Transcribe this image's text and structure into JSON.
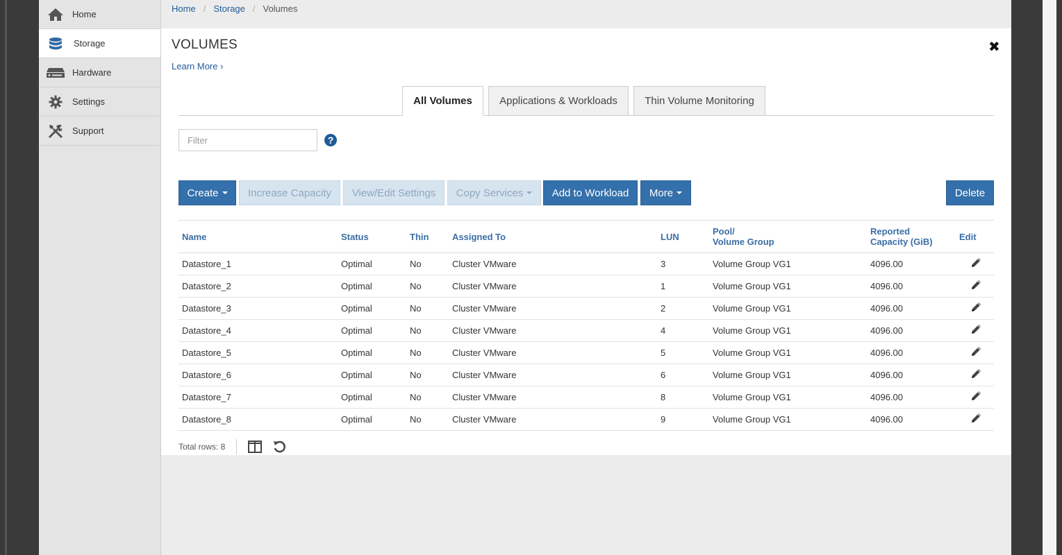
{
  "sidebar": {
    "items": [
      {
        "label": "Home",
        "icon": "home-icon"
      },
      {
        "label": "Storage",
        "icon": "database-icon"
      },
      {
        "label": "Hardware",
        "icon": "hardware-icon"
      },
      {
        "label": "Settings",
        "icon": "gear-icon"
      },
      {
        "label": "Support",
        "icon": "tools-icon"
      }
    ],
    "active": "Storage"
  },
  "breadcrumb": [
    "Home",
    "Storage",
    "Volumes"
  ],
  "page": {
    "title": "VOLUMES",
    "learn_more": "Learn More ›"
  },
  "tabs": [
    {
      "label": "All Volumes",
      "active": true
    },
    {
      "label": "Applications & Workloads",
      "active": false
    },
    {
      "label": "Thin Volume Monitoring",
      "active": false
    }
  ],
  "filter": {
    "placeholder": "Filter",
    "value": ""
  },
  "toolbar": {
    "create": "Create",
    "increase_capacity": "Increase Capacity",
    "view_edit": "View/Edit Settings",
    "copy_services": "Copy Services",
    "add_to_workload": "Add to Workload",
    "more": "More",
    "delete": "Delete"
  },
  "table": {
    "headers": {
      "name": "Name",
      "status": "Status",
      "thin": "Thin",
      "assigned": "Assigned To",
      "lun": "LUN",
      "pool_1": "Pool/",
      "pool_2": "Volume Group",
      "cap_1": "Reported",
      "cap_2": "Capacity (GiB)",
      "edit": "Edit"
    },
    "rows": [
      {
        "name": "Datastore_1",
        "status": "Optimal",
        "thin": "No",
        "assigned": "Cluster VMware",
        "lun": "3",
        "pool": "Volume Group VG1",
        "capacity": "4096.00"
      },
      {
        "name": "Datastore_2",
        "status": "Optimal",
        "thin": "No",
        "assigned": "Cluster VMware",
        "lun": "1",
        "pool": "Volume Group VG1",
        "capacity": "4096.00"
      },
      {
        "name": "Datastore_3",
        "status": "Optimal",
        "thin": "No",
        "assigned": "Cluster VMware",
        "lun": "2",
        "pool": "Volume Group VG1",
        "capacity": "4096.00"
      },
      {
        "name": "Datastore_4",
        "status": "Optimal",
        "thin": "No",
        "assigned": "Cluster VMware",
        "lun": "4",
        "pool": "Volume Group VG1",
        "capacity": "4096.00"
      },
      {
        "name": "Datastore_5",
        "status": "Optimal",
        "thin": "No",
        "assigned": "Cluster VMware",
        "lun": "5",
        "pool": "Volume Group VG1",
        "capacity": "4096.00"
      },
      {
        "name": "Datastore_6",
        "status": "Optimal",
        "thin": "No",
        "assigned": "Cluster VMware",
        "lun": "6",
        "pool": "Volume Group VG1",
        "capacity": "4096.00"
      },
      {
        "name": "Datastore_7",
        "status": "Optimal",
        "thin": "No",
        "assigned": "Cluster VMware",
        "lun": "8",
        "pool": "Volume Group VG1",
        "capacity": "4096.00"
      },
      {
        "name": "Datastore_8",
        "status": "Optimal",
        "thin": "No",
        "assigned": "Cluster VMware",
        "lun": "9",
        "pool": "Volume Group VG1",
        "capacity": "4096.00"
      }
    ]
  },
  "footer": {
    "total_rows": "Total rows: 8"
  },
  "colors": {
    "accent": "#3470ab",
    "link": "#1f5b99",
    "disabled": "#d6e4f0"
  }
}
